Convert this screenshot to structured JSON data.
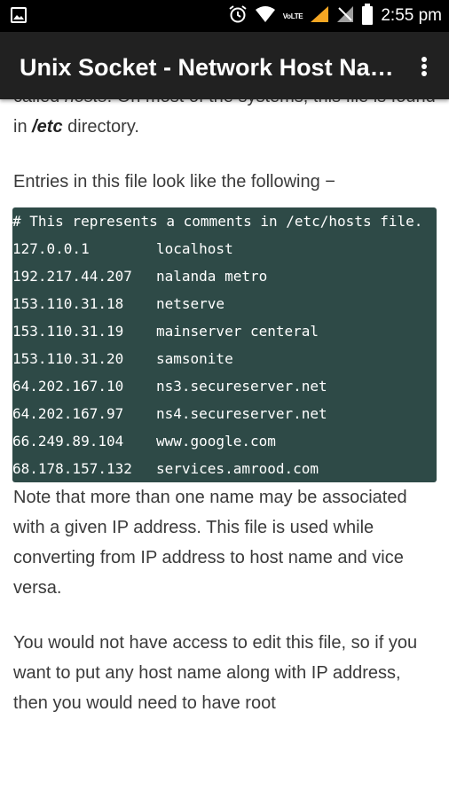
{
  "status_bar": {
    "network_label": "VoLTE",
    "time": "2:55 pm",
    "icons": [
      "image-icon",
      "alarm-icon",
      "wifi-icon",
      "signal-icon",
      "no-sim-icon",
      "battery-icon"
    ]
  },
  "app_bar": {
    "title": "Unix Socket - Network Host Na…"
  },
  "content": {
    "p1_start": "called ",
    "p1_em": "hosts",
    "p1_mid": ". On most of the systems, this file is found in ",
    "p1_strong": "/etc",
    "p1_end": " directory.",
    "p2": "Entries in this file look like the following −",
    "code_comment": "# This represents a comments in /etc/hosts file.",
    "hosts": [
      {
        "ip": "127.0.0.1",
        "name": "localhost"
      },
      {
        "ip": "192.217.44.207",
        "name": "nalanda metro"
      },
      {
        "ip": "153.110.31.18",
        "name": "netserve"
      },
      {
        "ip": "153.110.31.19",
        "name": "mainserver centeral"
      },
      {
        "ip": "153.110.31.20",
        "name": "samsonite"
      },
      {
        "ip": "64.202.167.10",
        "name": "ns3.secureserver.net"
      },
      {
        "ip": "64.202.167.97",
        "name": "ns4.secureserver.net"
      },
      {
        "ip": "66.249.89.104",
        "name": "www.google.com"
      },
      {
        "ip": "68.178.157.132",
        "name": "services.amrood.com"
      }
    ],
    "p3": "Note that more than one name may be associated with a given IP address. This file is used while converting from IP address to host name and vice versa.",
    "p4": "You would not have access to edit this file, so if you want to put any host name along with IP address, then you would need to have root"
  },
  "colors": {
    "status_bar_bg": "#000000",
    "app_bar_bg": "#212121",
    "code_bg": "#2e4a47",
    "text": "#3a3a3a",
    "signal_accent": "#f5a623"
  }
}
